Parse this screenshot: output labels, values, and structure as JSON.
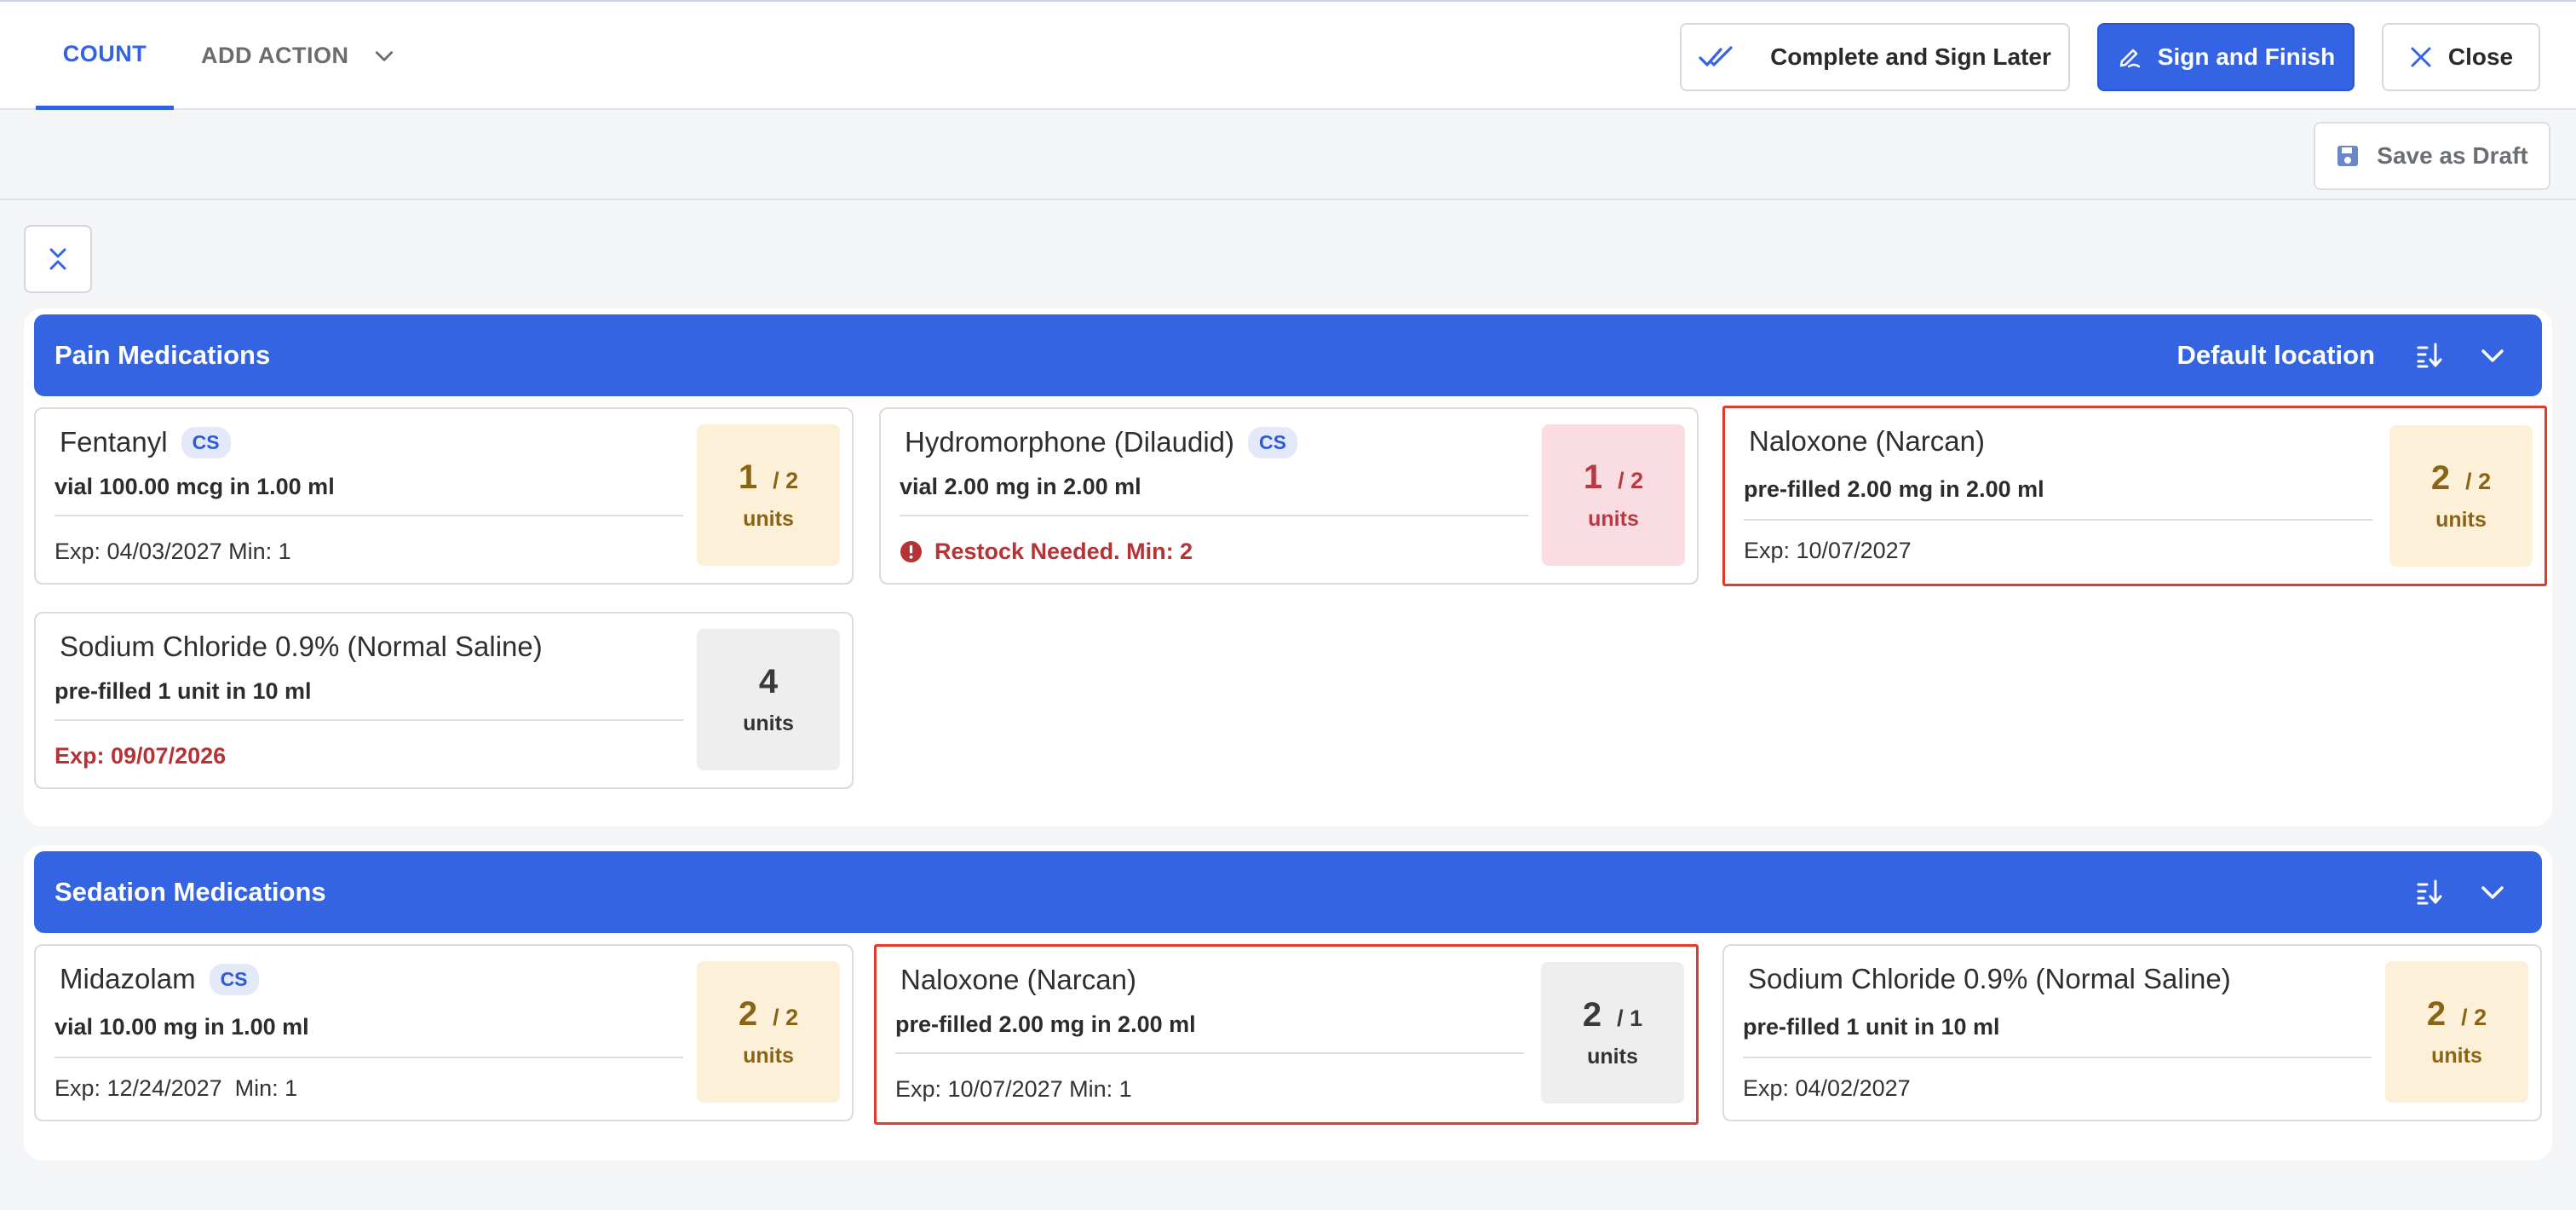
{
  "tabs": {
    "count": "COUNT",
    "add_action": "ADD ACTION"
  },
  "toolbar": {
    "complete_sign_later": "Complete and Sign Later",
    "sign_and_finish": "Sign and Finish",
    "close": "Close",
    "save_as_draft": "Save as Draft"
  },
  "colors": {
    "primary": "#3564e3",
    "selected_border": "#e23a2a",
    "qty_ok_bg": "#fdf0d8",
    "qty_low_bg": "#f9dde2",
    "qty_neutral_bg": "#eeeeee",
    "warning_text": "#b53235"
  },
  "sections": {
    "pain": {
      "title": "Pain Medications",
      "location": "Default location",
      "cards": [
        {
          "name": "Fentanyl",
          "cs": "CS",
          "desc": "vial 100.00 mcg in 1.00 ml",
          "foot": "Exp: 04/03/2027 Min: 1",
          "qty": "1",
          "of": "/ 2",
          "unit": "units",
          "status": "ok"
        },
        {
          "name": "Hydromorphone (Dilaudid)",
          "cs": "CS",
          "desc": "vial 2.00 mg in 2.00 ml",
          "foot": "Restock Needed.  Min: 2",
          "qty": "1",
          "of": "/ 2",
          "unit": "units",
          "status": "low"
        },
        {
          "name": "Naloxone (Narcan)",
          "desc": "pre-filled 2.00 mg in 2.00 ml",
          "foot": "Exp: 10/07/2027",
          "qty": "2",
          "of": "/ 2",
          "unit": "units",
          "status": "ok",
          "selected": true
        },
        {
          "name": "Sodium Chloride 0.9% (Normal Saline)",
          "desc": "pre-filled 1 unit in 10 ml",
          "foot": "Exp: 09/07/2026",
          "qty": "4",
          "unit": "units",
          "status": "neutral",
          "foot_warn": true
        }
      ]
    },
    "sedation": {
      "title": "Sedation Medications",
      "cards": [
        {
          "name": "Midazolam",
          "cs": "CS",
          "desc": "vial 10.00 mg in 1.00 ml",
          "foot": "Exp: 12/24/2027  Min: 1",
          "qty": "2",
          "of": "/ 2",
          "unit": "units",
          "status": "ok"
        },
        {
          "name": "Naloxone (Narcan)",
          "desc": "pre-filled 2.00 mg in 2.00 ml",
          "foot": "Exp: 10/07/2027 Min: 1",
          "qty": "2",
          "of": "/ 1",
          "unit": "units",
          "status": "neutral",
          "selected": true
        },
        {
          "name": "Sodium Chloride 0.9% (Normal Saline)",
          "desc": "pre-filled 1 unit in 10 ml",
          "foot": "Exp: 04/02/2027",
          "qty": "2",
          "of": "/ 2",
          "unit": "units",
          "status": "ok"
        }
      ]
    }
  }
}
